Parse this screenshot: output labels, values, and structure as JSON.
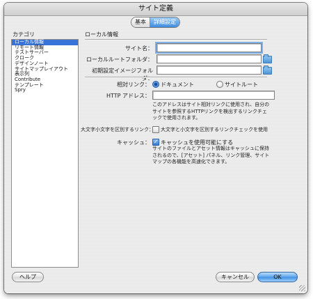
{
  "window": {
    "title": "サイト定義"
  },
  "tabs": [
    {
      "label": "基本",
      "active": false
    },
    {
      "label": "詳細設定",
      "active": true
    }
  ],
  "category": {
    "label": "カテゴリ",
    "items": [
      "ローカル情報",
      "リモート情報",
      "テストサーバー",
      "クローク",
      "デザインノート",
      "サイトマップレイアウト",
      "表示列",
      "Contribute",
      "テンプレート",
      "Spry"
    ],
    "selected": "ローカル情報"
  },
  "local_info": {
    "title": "ローカル情報",
    "site_name_label": "サイト名：",
    "site_name_value": "",
    "root_folder_label": "ローカルルートフォルダ：",
    "root_folder_value": "",
    "image_folder_label": "初期設定イメージフォルダ：",
    "image_folder_value": "",
    "links_label": "相対リンク：",
    "link_option_document": "ドキュメント",
    "link_option_root": "サイトルート",
    "link_selected": "document",
    "http_label": "HTTP アドレス：",
    "http_value": "",
    "http_help": "このアドレスはサイト相対リンクに使用され、自分のサイトを参照するHTTPリンクを検出するリンクチェックで使用されます。",
    "case_label": "大文字小文字を区別するリンク：",
    "case_checkbox": "大文字と小文字を区別するリンクチェックを使用",
    "case_checked": false,
    "cache_label": "キャッシュ：",
    "cache_checkbox": "キャッシュを使用可能にする",
    "cache_checked": true,
    "cache_help": "サイトのファイルとアセット情報はキャッシュに保持されるので、[アセット] パネル、リンク管理、サイトマップの各機能を高速化できます。"
  },
  "footer": {
    "help_label": "ヘルプ",
    "cancel_label": "キャンセル",
    "ok_label": "OK"
  },
  "colors": {
    "accent": "#3874d7",
    "default_button": "#4d9be8"
  }
}
